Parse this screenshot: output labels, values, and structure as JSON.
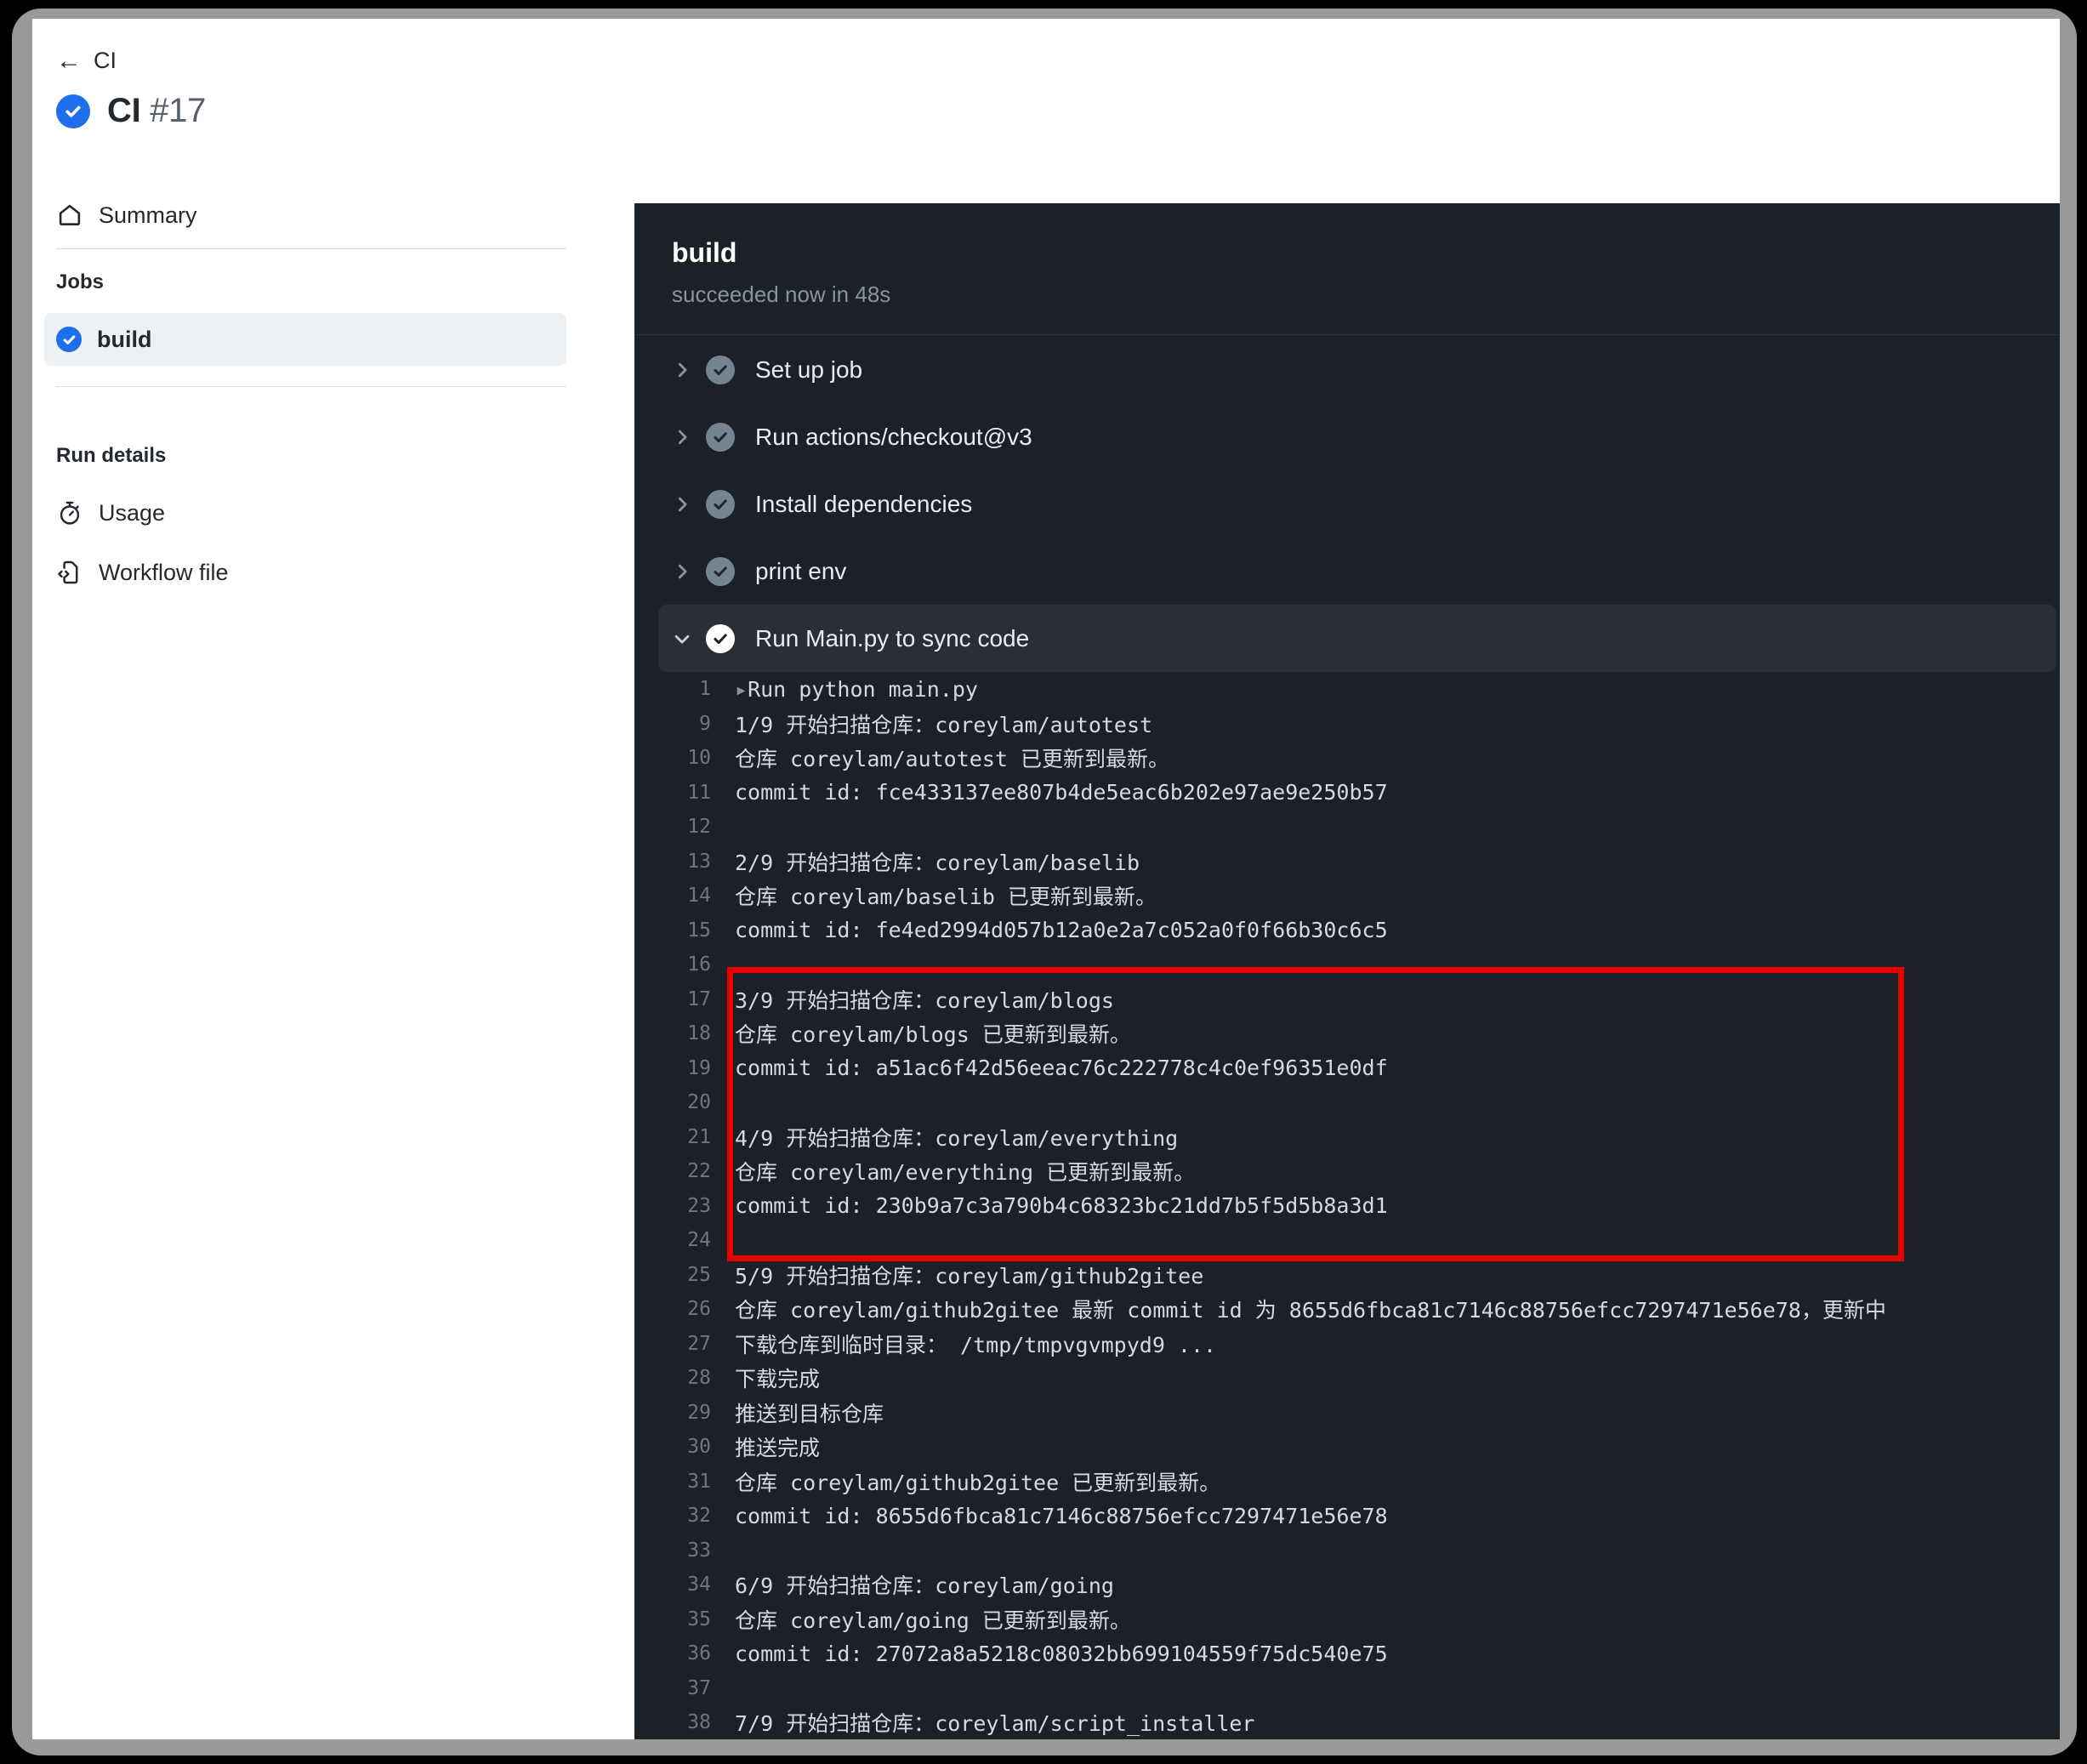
{
  "breadcrumb": {
    "back_icon": "arrow-left-icon",
    "label": "CI"
  },
  "run_header": {
    "status_icon": "check-circle-icon",
    "workflow_name": "CI",
    "run_number": "#17"
  },
  "sidebar": {
    "summary": {
      "icon": "home-icon",
      "label": "Summary"
    },
    "jobs_heading": "Jobs",
    "jobs": [
      {
        "icon": "check-circle-icon",
        "label": "build",
        "selected": true
      }
    ],
    "run_details_heading": "Run details",
    "run_details": [
      {
        "icon": "stopwatch-icon",
        "label": "Usage"
      },
      {
        "icon": "workflow-file-icon",
        "label": "Workflow file"
      }
    ]
  },
  "log": {
    "job_name": "build",
    "job_status": "succeeded now in 48s",
    "steps": [
      {
        "label": "Set up job",
        "expanded": false,
        "status": "success"
      },
      {
        "label": "Run actions/checkout@v3",
        "expanded": false,
        "status": "success"
      },
      {
        "label": "Install dependencies",
        "expanded": false,
        "status": "success"
      },
      {
        "label": "print env",
        "expanded": false,
        "status": "success"
      },
      {
        "label": "Run Main.py to sync code",
        "expanded": true,
        "status": "success"
      }
    ],
    "lines": [
      {
        "n": "1",
        "t": "▸Run python main.py"
      },
      {
        "n": "9",
        "t": "1/9 开始扫描仓库：coreylam/autotest"
      },
      {
        "n": "10",
        "t": "仓库 coreylam/autotest 已更新到最新。"
      },
      {
        "n": "11",
        "t": "commit id: fce433137ee807b4de5eac6b202e97ae9e250b57"
      },
      {
        "n": "12",
        "t": ""
      },
      {
        "n": "13",
        "t": "2/9 开始扫描仓库：coreylam/baselib"
      },
      {
        "n": "14",
        "t": "仓库 coreylam/baselib 已更新到最新。"
      },
      {
        "n": "15",
        "t": "commit id: fe4ed2994d057b12a0e2a7c052a0f0f66b30c6c5"
      },
      {
        "n": "16",
        "t": ""
      },
      {
        "n": "17",
        "t": "3/9 开始扫描仓库：coreylam/blogs"
      },
      {
        "n": "18",
        "t": "仓库 coreylam/blogs 已更新到最新。"
      },
      {
        "n": "19",
        "t": "commit id: a51ac6f42d56eeac76c222778c4c0ef96351e0df"
      },
      {
        "n": "20",
        "t": ""
      },
      {
        "n": "21",
        "t": "4/9 开始扫描仓库：coreylam/everything"
      },
      {
        "n": "22",
        "t": "仓库 coreylam/everything 已更新到最新。"
      },
      {
        "n": "23",
        "t": "commit id: 230b9a7c3a790b4c68323bc21dd7b5f5d5b8a3d1"
      },
      {
        "n": "24",
        "t": ""
      },
      {
        "n": "25",
        "t": "5/9 开始扫描仓库：coreylam/github2gitee"
      },
      {
        "n": "26",
        "t": "仓库 coreylam/github2gitee 最新 commit id 为 8655d6fbca81c7146c88756efcc7297471e56e78，更新中"
      },
      {
        "n": "27",
        "t": "下载仓库到临时目录： /tmp/tmpvgvmpyd9 ..."
      },
      {
        "n": "28",
        "t": "下载完成"
      },
      {
        "n": "29",
        "t": "推送到目标仓库"
      },
      {
        "n": "30",
        "t": "推送完成"
      },
      {
        "n": "31",
        "t": "仓库 coreylam/github2gitee 已更新到最新。"
      },
      {
        "n": "32",
        "t": "commit id: 8655d6fbca81c7146c88756efcc7297471e56e78"
      },
      {
        "n": "33",
        "t": ""
      },
      {
        "n": "34",
        "t": "6/9 开始扫描仓库：coreylam/going"
      },
      {
        "n": "35",
        "t": "仓库 coreylam/going 已更新到最新。"
      },
      {
        "n": "36",
        "t": "commit id: 27072a8a5218c08032bb699104559f75dc540e75"
      },
      {
        "n": "37",
        "t": ""
      },
      {
        "n": "38",
        "t": "7/9 开始扫描仓库：coreylam/script_installer"
      }
    ],
    "annotation": {
      "shape": "rectangle",
      "color": "#e60000",
      "covers_lines": "25-32"
    }
  },
  "colors": {
    "accent_blue": "#1f6feb",
    "log_background": "#1c2128",
    "annotation_red": "#e60000"
  }
}
